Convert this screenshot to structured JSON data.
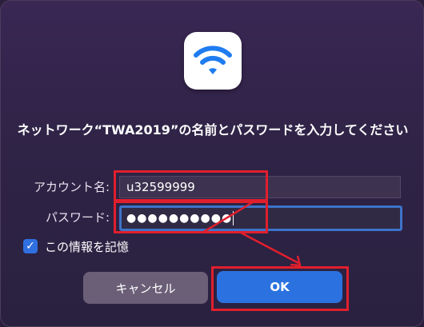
{
  "dialog": {
    "message": "ネットワーク“TWA2019”の名前とパスワードを入力してください",
    "account_label": "アカウント名:",
    "account_value": "u32599999",
    "password_label": "パスワード:",
    "password_masked": "●●●●●●●●●●",
    "remember_label": "この情報を記憶",
    "remember_checked": true,
    "cancel_label": "キャンセル",
    "ok_label": "OK"
  },
  "icons": {
    "app": "wifi-icon",
    "checkbox": "checkmark-icon"
  },
  "colors": {
    "accent": "#2b72e0",
    "annotation": "#e01f2d"
  }
}
